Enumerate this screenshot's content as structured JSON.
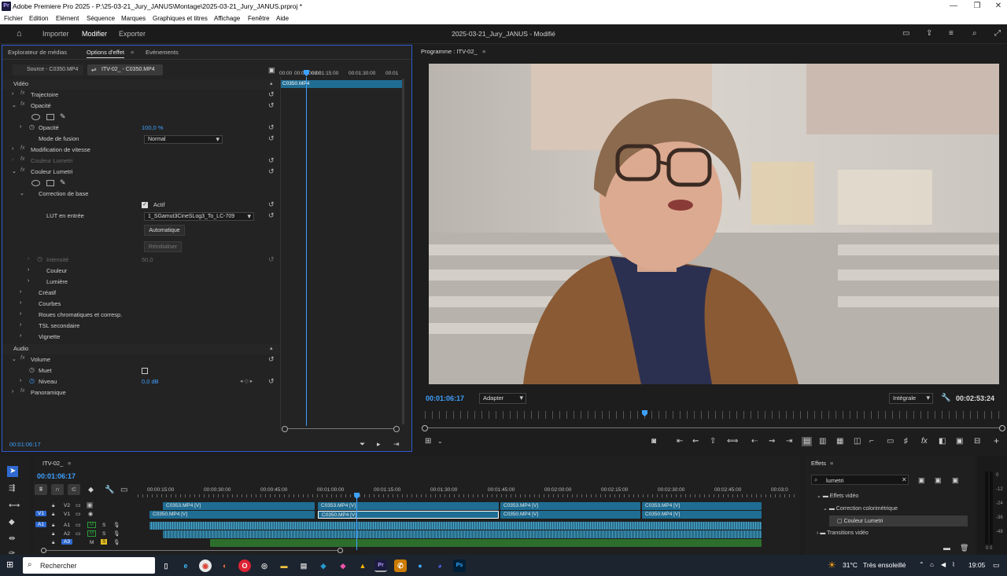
{
  "window": {
    "title": "Adobe Premiere Pro 2025 - P:\\25-03-21_Jury_JANUS\\Montage\\2025-03-21_Jury_JANUS.prproj *",
    "icon_text": "Pr"
  },
  "menu": [
    "Fichier",
    "Edition",
    "Elément",
    "Séquence",
    "Marques",
    "Graphiques et titres",
    "Affichage",
    "Fenêtre",
    "Aide"
  ],
  "workspaces": {
    "import": "Importer",
    "edit": "Modifier",
    "export": "Exporter"
  },
  "project_title": "2025-03-21_Jury_JANUS - Modifié",
  "effect_panel": {
    "tabs": [
      "Explorateur de médias",
      "Options d'effet",
      "Evénements"
    ],
    "source_tab": "Source - C0350.MP4",
    "sequence_tab": "ITV-02_ - C0350.MP4",
    "ruler": [
      "00:00",
      "00:01:00:00",
      "00:01:15:00",
      "00:01:30:00",
      "00:01"
    ],
    "clip_name": "C0350.MP4",
    "video_header": "Vidéo",
    "audio_header": "Audio",
    "timecode": "00:01:06:17",
    "rows": {
      "trajectoire": "Trajectoire",
      "opacite": "Opacité",
      "opacite_param": "Opacité",
      "opacite_value": "100,0 %",
      "mode_fusion": "Mode de fusion",
      "mode_fusion_value": "Normal",
      "vitesse": "Modification de vitesse",
      "lumetri1": "Couleur Lumetri",
      "lumetri2": "Couleur Lumetri",
      "correction_base": "Correction de base",
      "actif": "Actif",
      "lut_label": "LUT en entrée",
      "lut_value": "1_SGamut3CineSLog3_To_LC-709",
      "auto_btn": "Automatique",
      "reset_btn": "Réinitialiser",
      "intensite": "Intensité",
      "intensite_value": "50,0",
      "couleur": "Couleur",
      "lumiere": "Lumière",
      "creatif": "Créatif",
      "courbes": "Courbes",
      "roues": "Roues chromatiques et corresp.",
      "tsl": "TSL secondaire",
      "vignette": "Vignette",
      "volume": "Volume",
      "muet": "Muet",
      "niveau": "Niveau",
      "niveau_value": "0,0 dB",
      "panoramique": "Panoramique"
    }
  },
  "program": {
    "title": "Programme : ITV-02_",
    "timecode": "00:01:06:17",
    "fit": "Adapter",
    "quality": "Intégrale",
    "duration": "00:02:53:24"
  },
  "timeline": {
    "sequence": "ITV-02_",
    "timecode": "00:01:06:17",
    "ruler": [
      "00:00:15:00",
      "00:00:30:00",
      "00:00:45:00",
      "00:01:00:00",
      "00:01:15:00",
      "00:01:30:00",
      "00:01:45:00",
      "00:02:00:00",
      "00:02:15:00",
      "00:02:30:00",
      "00:02:45:00",
      "00:03:0"
    ],
    "tracks": [
      "V2",
      "V1",
      "A1",
      "A2",
      "A3"
    ],
    "track_targets": {
      "v1": "V1",
      "a1": "A1",
      "a3": "A3"
    },
    "clips_v2": [
      "C0353.MP4 [V]",
      "C0353.MP4 [V]",
      "C0353.MP4 [V]",
      "C0353.MP4 [V]"
    ],
    "clips_v1": [
      "C0350.MP4 [V]",
      "C0350.MP4 [V]",
      "C0350.MP4 [V]",
      "C0350.MP4 [V]"
    ]
  },
  "effects": {
    "title": "Effets",
    "search": "lumetri",
    "tree": [
      "Effets vidéo",
      "Correction colorimétrique",
      "Couleur Lumetri",
      "Transitions vidéo"
    ]
  },
  "meters": {
    "scale": [
      "0",
      "-12",
      "-24",
      "-36",
      "-48"
    ],
    "bottom": "0 0"
  },
  "taskbar": {
    "search": "Rechercher",
    "weather": "31°C",
    "weather_desc": "Très ensoleillé",
    "time": "19:05"
  },
  "colors": {
    "accent": "#2f5ad0",
    "timecode": "#3ea0ff",
    "video_clip": "#1f6d93"
  }
}
